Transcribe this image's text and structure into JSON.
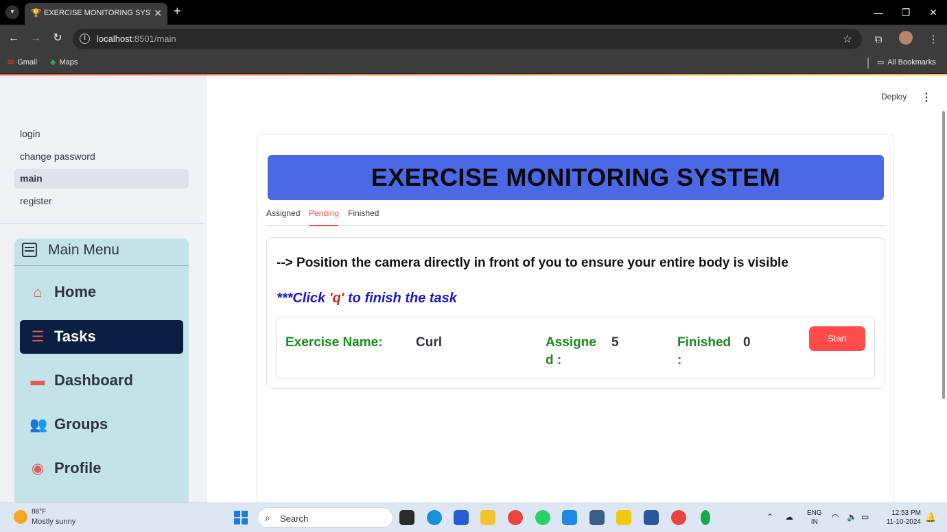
{
  "browser": {
    "tab_title": "EXERCISE MONITORING SYSTEM",
    "url_host": "localhost",
    "url_path": ":8501/main",
    "bookmarks": [
      "Gmail",
      "Maps"
    ],
    "all_bookmarks": "All Bookmarks"
  },
  "sidebar": {
    "pages": [
      {
        "label": "login",
        "active": false
      },
      {
        "label": "change password",
        "active": false
      },
      {
        "label": "main",
        "active": true
      },
      {
        "label": "register",
        "active": false
      }
    ],
    "menu_title": "Main Menu",
    "menu_items": [
      {
        "label": "Home",
        "icon": "house-icon",
        "active": false
      },
      {
        "label": "Tasks",
        "icon": "list-icon",
        "active": true
      },
      {
        "label": "Dashboard",
        "icon": "monitor-icon",
        "active": false
      },
      {
        "label": "Groups",
        "icon": "people-icon",
        "active": false
      },
      {
        "label": "Profile",
        "icon": "person-circle-icon",
        "active": false
      }
    ]
  },
  "header": {
    "deploy": "Deploy"
  },
  "main": {
    "banner_title": "EXERCISE MONITORING SYSTEM",
    "tabs": [
      "Assigned",
      "Pending",
      "Finished"
    ],
    "active_tab": "Pending",
    "instruction": "--> Position the camera directly in front of you to ensure your entire body is visible",
    "click_note_prefix": "***Click ",
    "click_note_key": "'q'",
    "click_note_suffix": " to finish the task",
    "task": {
      "name_label": "Exercise Name:",
      "name_value": "Curl",
      "assigned_label_1": "Assigne",
      "assigned_label_2": "d :",
      "assigned_value": "5",
      "finished_label_1": "Finished",
      "finished_label_2": ":",
      "finished_value": "0",
      "start_label": "Start"
    }
  },
  "taskbar": {
    "temp": "88°F",
    "weather": "Mostly sunny",
    "search": "Search",
    "lang_1": "ENG",
    "lang_2": "IN",
    "time": "12:53 PM",
    "date": "11-10-2024"
  }
}
